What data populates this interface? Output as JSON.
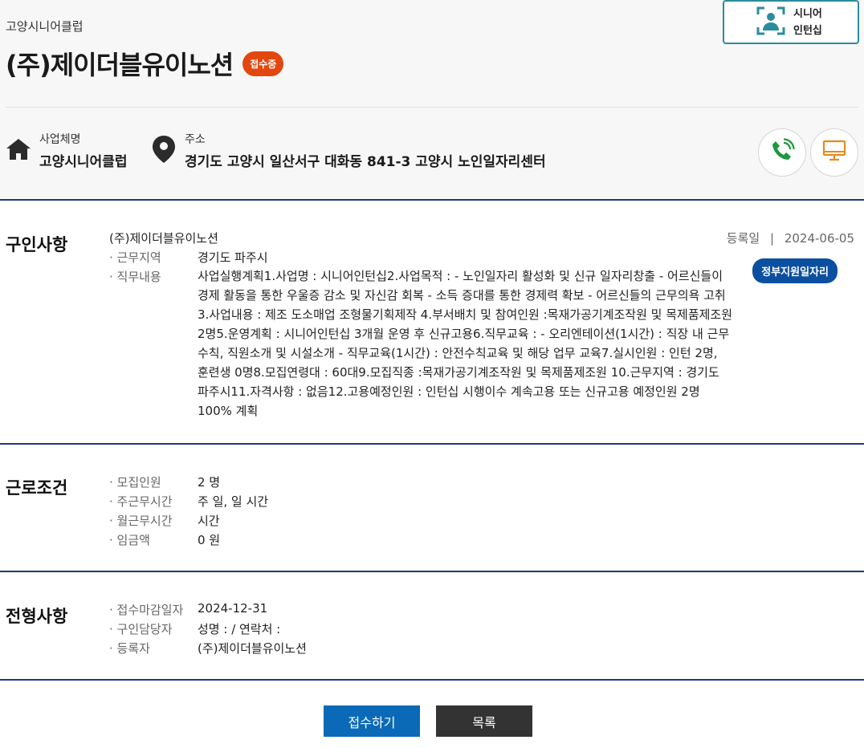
{
  "header": {
    "org_small": "고양시니어클럽",
    "title": "(주)제이더블유이노션",
    "status_badge": "접수중",
    "senior_button_label": "시니어\n인턴십"
  },
  "info": {
    "business_label": "사업체명",
    "business_value": "고양시니어클럽",
    "address_label": "주소",
    "address_value": "경기도 고양시 일산서구 대화동 841-3 고양시 노인일자리센터"
  },
  "recruit": {
    "section_title": "구인사항",
    "company": "(주)제이더블유이노션",
    "reg_label": "등록일",
    "reg_sep": "|",
    "reg_date": "2024-06-05",
    "gov_badge": "정부지원일자리",
    "work_area_label": "· 근무지역",
    "work_area_value": "경기도 파주시",
    "job_desc_label": "· 직무내용",
    "job_desc_value": "사업실행계획1.사업명 : 시니어인턴십2.사업목적 : - 노인일자리 활성화 및 신규 일자리창출 - 어르신들이 경제 활동을 통한 우울증 감소 및 자신감 회복 - 소득 증대를 통한 경제력 확보 - 어르신들의 근무의욕 고취3.사업내용 : 제조 도소매업 조형물기획제작 4.부서배치 및 참여인원 :목재가공기계조작원 및 목제품제조원 2명5.운영계획 : 시니어인턴십 3개월 운영 후 신규고용6.직무교육 : - 오리엔테이션(1시간) : 직장 내 근무수칙, 직원소개 및 시설소개 - 직무교육(1시간) : 안전수칙교육 및 해당 업무 교육7.실시인원 : 인턴 2명, 훈련생 0명8.모집연령대 : 60대9.모집직종 :목재가공기계조작원 및 목제품제조원 10.근무지역 : 경기도 파주시11.자격사항 : 없음12.고용예정인원 : 인턴십 시행이수 계속고용 또는 신규고용 예정인원 2명 100% 계획"
  },
  "conditions": {
    "section_title": "근로조건",
    "rows": [
      {
        "label": "· 모집인원",
        "value": "2 명"
      },
      {
        "label": "· 주근무시간",
        "value": "주 일, 일 시간"
      },
      {
        "label": "· 월근무시간",
        "value": "시간"
      },
      {
        "label": "· 임금액",
        "value": "0 원"
      }
    ]
  },
  "screening": {
    "section_title": "전형사항",
    "rows": [
      {
        "label": "· 접수마감일자",
        "value": "2024-12-31"
      },
      {
        "label": "· 구인담당자",
        "value": "성명 : / 연락처 :"
      },
      {
        "label": "· 등록자",
        "value": "(주)제이더블유이노션"
      }
    ]
  },
  "buttons": {
    "apply": "접수하기",
    "list": "목록"
  },
  "colors": {
    "accent_navy": "#1c3d74",
    "badge_orange": "#e3470f",
    "gov_blue": "#0b4fa0",
    "apply_blue": "#0b6ab7",
    "list_dark": "#333333",
    "teal": "#2a8c9c",
    "phone_green": "#1a9a3c",
    "monitor_orange": "#e8891a"
  }
}
